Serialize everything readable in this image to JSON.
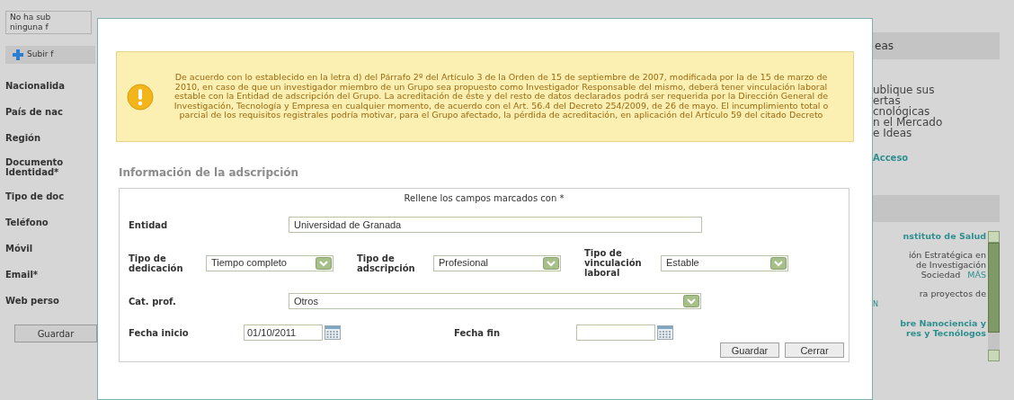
{
  "background_left": {
    "photo_note": [
      "No ha sub",
      "ninguna f"
    ],
    "upload_button": "Subir f",
    "labels": [
      "Nacionalida",
      "País de nac",
      "Región",
      "Documento\nIdentidad*",
      "Tipo de doc",
      "Teléfono",
      "Móvil",
      "Email*",
      "Web perso"
    ],
    "save_button": "Guardar"
  },
  "modal": {
    "warning": "De acuerdo con lo establecido en la letra d) del Párrafo 2º del Artículo 3 de la Orden de 15 de septiembre de 2007, modificada por la de 15 de marzo de 2010, en caso de que un investigador miembro de un Grupo sea propuesto como Investigador Responsable del mismo, deberá tener vinculación laboral estable con la Entidad de adscripción del Grupo. La acreditación de éste y del resto de datos declarados podrá ser requerida por la Dirección General de Investigación, Tecnología y Empresa en cualquier momento, de acuerdo con el Art. 56.4 del Decreto 254/2009, de 26 de mayo. El incumplimiento total o parcial de los requisitos registrales podría motivar, para el Grupo afectado, la pérdida de acreditación, en aplicación del Artículo 59 del citado Decreto",
    "section_title": "Información de la adscripción",
    "form": {
      "note": "Rellene los campos marcados con *",
      "rows": [
        {
          "fields": [
            {
              "label": "Entidad",
              "kind": "text",
              "value": "Universidad de Granada"
            }
          ]
        },
        {
          "fields": [
            {
              "label": "Tipo de dedicación",
              "kind": "select",
              "value": "Tiempo completo"
            },
            {
              "label": "Tipo de adscripción",
              "kind": "select",
              "value": "Profesional"
            },
            {
              "label": "Tipo de vinculación laboral",
              "kind": "select",
              "value": "Estable"
            }
          ]
        },
        {
          "fields": [
            {
              "label": "Cat. prof.",
              "kind": "select",
              "value": "Otros"
            }
          ]
        },
        {
          "fields": [
            {
              "label": "Fecha inicio",
              "kind": "date",
              "value": "01/10/2011"
            },
            {
              "label": "Fecha fin",
              "kind": "date"
            }
          ]
        }
      ],
      "buttons": [
        "Guardar",
        "Cerrar"
      ]
    }
  },
  "background_right": {
    "panel_1": {
      "header": "eas",
      "lines": [
        "ublique sus",
        "ertas",
        "cnológicas",
        "n el Mercado",
        "e Ideas"
      ],
      "link": "Acceso"
    },
    "panel_2": {
      "items": [
        {
          "kind": "link",
          "lines": [
            "nstituto de Salud"
          ]
        },
        {
          "kind": "text",
          "lines": [
            "ión Estratégica en",
            "de Investigación",
            "Sociedad"
          ],
          "more": "MÁS"
        },
        {
          "kind": "text",
          "lines": [
            "ra proyectos de"
          ]
        },
        {
          "kind": "note",
          "lines": [
            "N"
          ]
        },
        {
          "kind": "link",
          "lines": [
            "bre Nanociencia y",
            "res y Tecnólogos"
          ]
        }
      ]
    }
  }
}
